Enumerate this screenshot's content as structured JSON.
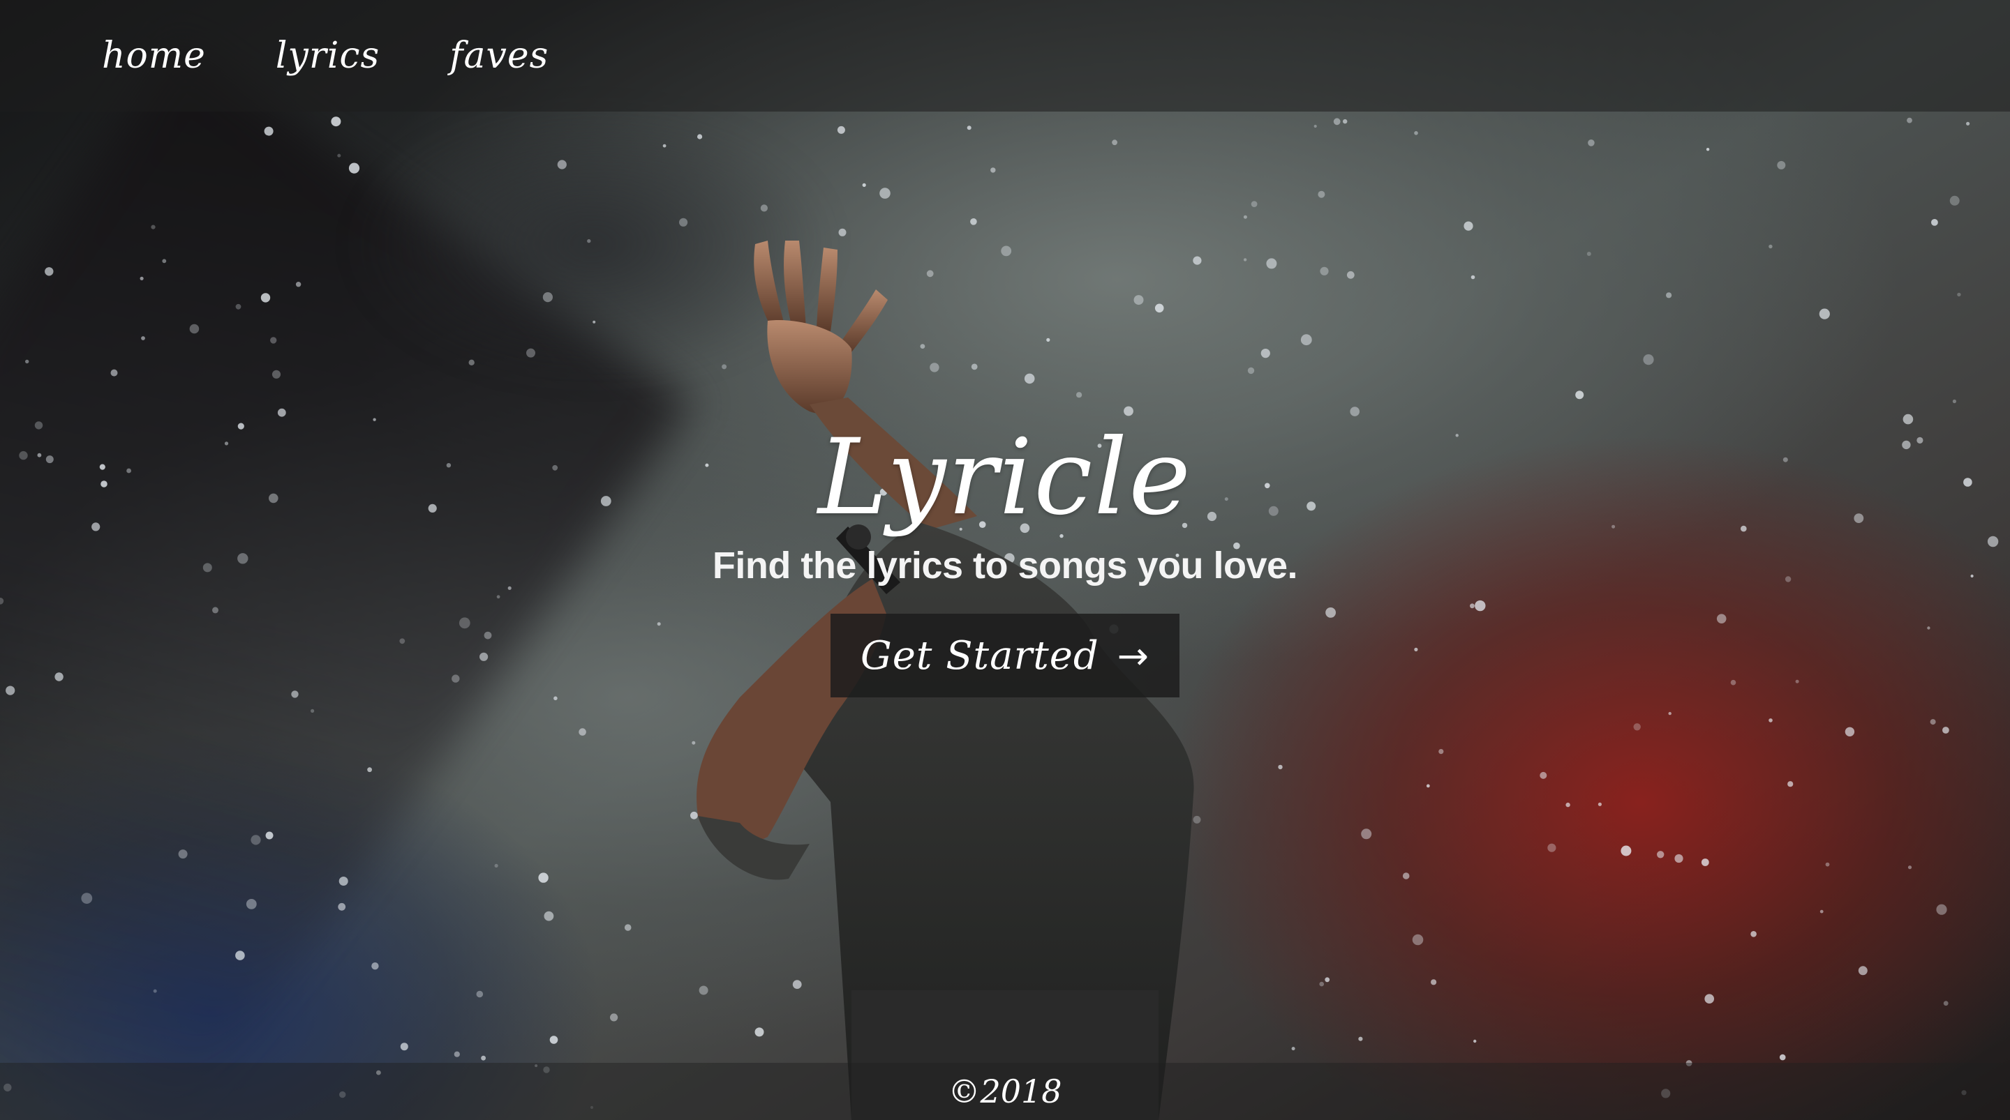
{
  "nav": {
    "items": [
      {
        "label": "home"
      },
      {
        "label": "lyrics"
      },
      {
        "label": "faves"
      }
    ]
  },
  "hero": {
    "title": "Lyricle",
    "subtitle": "Find the lyrics to songs you love.",
    "cta_label": "Get Started",
    "cta_icon": "arrow-right-icon",
    "background": "concert-performer-photo"
  },
  "footer": {
    "copyright": "©2018"
  },
  "colors": {
    "text": "#ffffff",
    "nav_bg": "#1e1e1e",
    "button_bg": "#1c1c1c",
    "smoke_red": "#961e19",
    "smoke_blue": "#192d5f"
  }
}
